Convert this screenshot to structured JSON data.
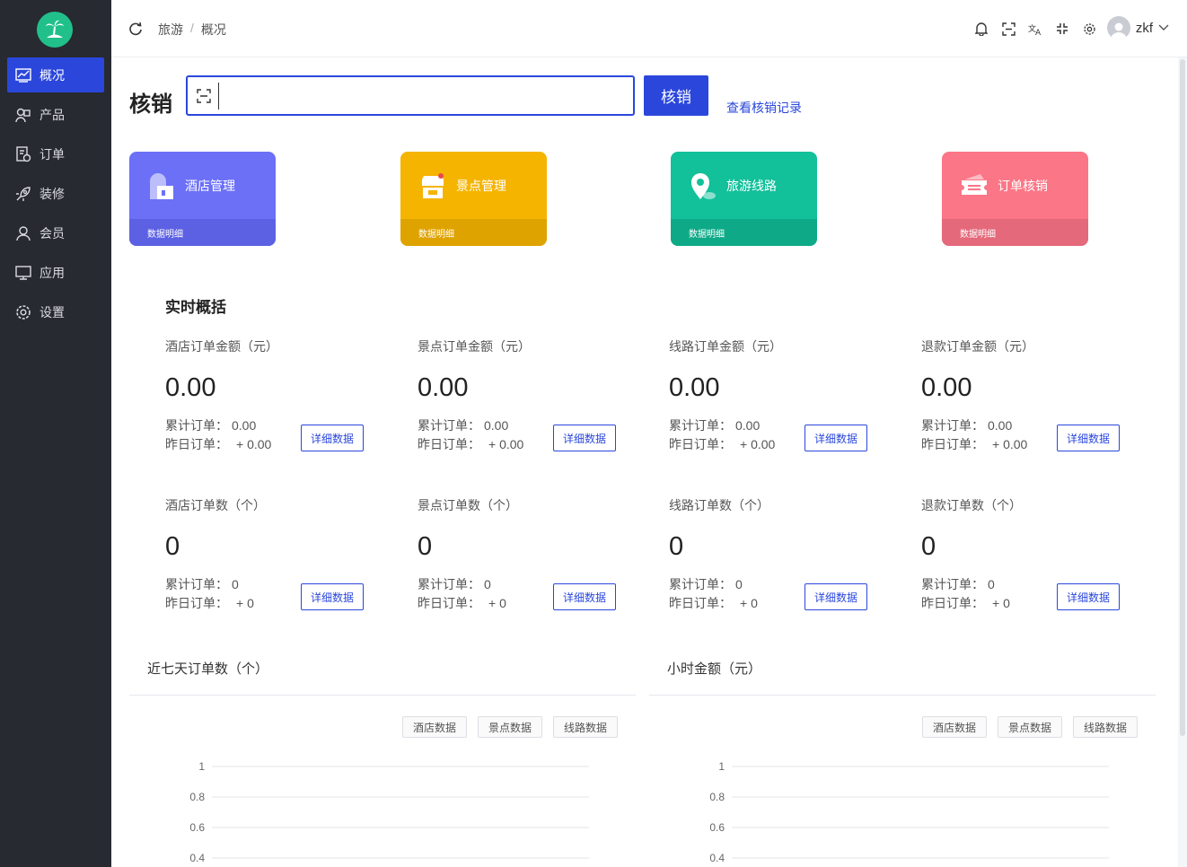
{
  "sidebar": {
    "items": [
      {
        "label": "概况",
        "icon": "chart-line-icon",
        "active": true
      },
      {
        "label": "产品",
        "icon": "product-icon",
        "active": false
      },
      {
        "label": "订单",
        "icon": "order-icon",
        "active": false
      },
      {
        "label": "装修",
        "icon": "rocket-icon",
        "active": false
      },
      {
        "label": "会员",
        "icon": "user-icon",
        "active": false
      },
      {
        "label": "应用",
        "icon": "monitor-icon",
        "active": false
      },
      {
        "label": "设置",
        "icon": "gear-icon",
        "active": false
      }
    ]
  },
  "header": {
    "breadcrumb": [
      "旅游",
      "概况"
    ],
    "separator": "/",
    "username": "zkf"
  },
  "verify": {
    "title": "核销",
    "input_value": "",
    "button": "核销",
    "records_link": "查看核销记录"
  },
  "cards": [
    {
      "label": "酒店管理",
      "sub": "数据明细",
      "color": "#6b70f7",
      "bottom": "#5c61e3",
      "icon": "hotel-icon"
    },
    {
      "label": "景点管理",
      "sub": "数据明细",
      "color": "#f5b400",
      "bottom": "#dfa300",
      "icon": "shop-icon"
    },
    {
      "label": "旅游线路",
      "sub": "数据明细",
      "color": "#12c09a",
      "bottom": "#0eaa88",
      "icon": "map-pin-icon"
    },
    {
      "label": "订单核销",
      "sub": "数据明细",
      "color": "#fb7686",
      "bottom": "#e4697a",
      "icon": "ticket-icon"
    }
  ],
  "realtime": {
    "title": "实时概括",
    "stats": [
      {
        "label": "酒店订单金额（元）",
        "value": "0.00",
        "total_label": "累计订单：",
        "total": "0.00",
        "yest_label": "昨日订单：",
        "yest": "+ 0.00",
        "button": "详细数据"
      },
      {
        "label": "景点订单金额（元）",
        "value": "0.00",
        "total_label": "累计订单：",
        "total": "0.00",
        "yest_label": "昨日订单：",
        "yest": "+ 0.00",
        "button": "详细数据"
      },
      {
        "label": "线路订单金额（元）",
        "value": "0.00",
        "total_label": "累计订单：",
        "total": "0.00",
        "yest_label": "昨日订单：",
        "yest": "+ 0.00",
        "button": "详细数据"
      },
      {
        "label": "退款订单金额（元）",
        "value": "0.00",
        "total_label": "累计订单：",
        "total": "0.00",
        "yest_label": "昨日订单：",
        "yest": "+ 0.00",
        "button": "详细数据"
      },
      {
        "label": "酒店订单数（个）",
        "value": "0",
        "total_label": "累计订单：",
        "total": "0",
        "yest_label": "昨日订单：",
        "yest": "+ 0",
        "button": "详细数据"
      },
      {
        "label": "景点订单数（个）",
        "value": "0",
        "total_label": "累计订单：",
        "total": "0",
        "yest_label": "昨日订单：",
        "yest": "+ 0",
        "button": "详细数据"
      },
      {
        "label": "线路订单数（个）",
        "value": "0",
        "total_label": "累计订单：",
        "total": "0",
        "yest_label": "昨日订单：",
        "yest": "+ 0",
        "button": "详细数据"
      },
      {
        "label": "退款订单数（个）",
        "value": "0",
        "total_label": "累计订单：",
        "total": "0",
        "yest_label": "昨日订单：",
        "yest": "+ 0",
        "button": "详细数据"
      }
    ]
  },
  "charts": {
    "left": {
      "title": "近七天订单数（个）",
      "buttons": [
        "酒店数据",
        "景点数据",
        "线路数据"
      ]
    },
    "right": {
      "title": "小时金额（元）",
      "buttons": [
        "酒店数据",
        "景点数据",
        "线路数据"
      ]
    }
  },
  "chart_data": [
    {
      "type": "line",
      "title": "近七天订单数（个）",
      "series": [],
      "yticks": [
        "1",
        "0.8",
        "0.6",
        "0.4"
      ],
      "ylim": [
        0,
        1
      ],
      "grid": true
    },
    {
      "type": "line",
      "title": "小时金额（元）",
      "series": [],
      "yticks": [
        "1",
        "0.8",
        "0.6",
        "0.4"
      ],
      "ylim": [
        0,
        1
      ],
      "grid": true
    }
  ]
}
